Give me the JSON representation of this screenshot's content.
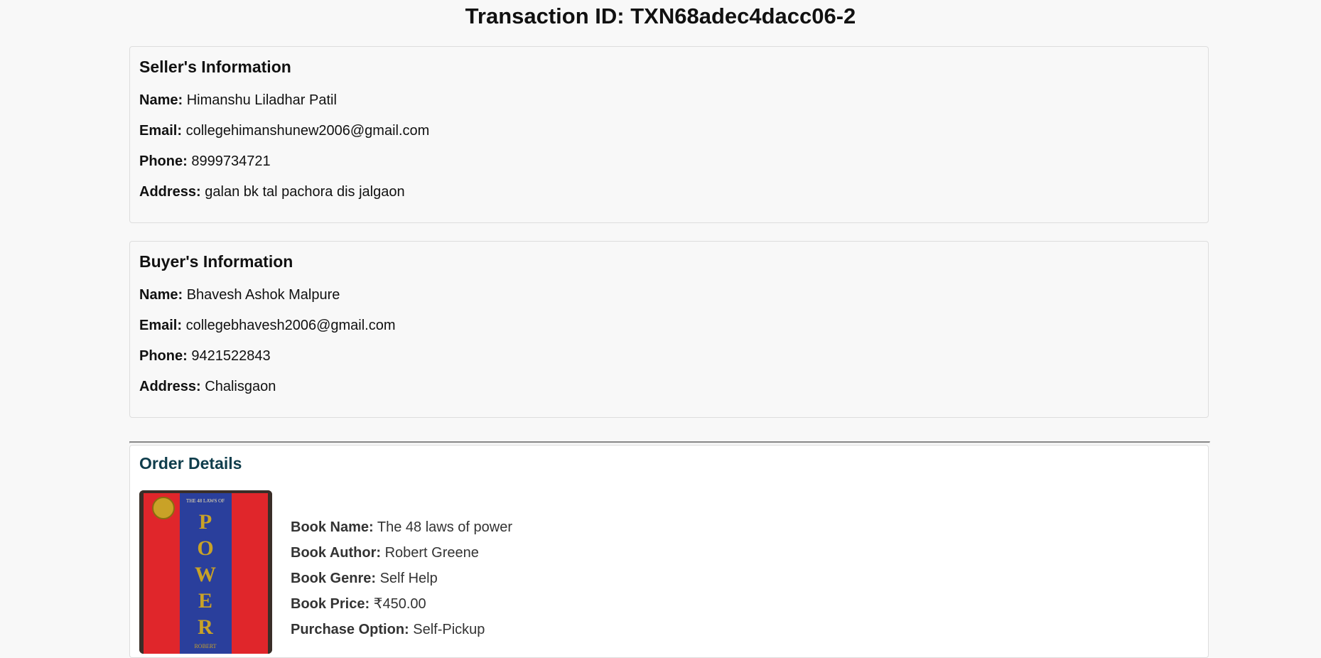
{
  "page": {
    "title": "Transaction ID: TXN68adec4dacc06-2"
  },
  "seller": {
    "heading": "Seller's Information",
    "name_label": "Name:",
    "name": "Himanshu Liladhar Patil",
    "email_label": "Email:",
    "email": "collegehimanshunew2006@gmail.com",
    "phone_label": "Phone:",
    "phone": "8999734721",
    "address_label": "Address:",
    "address": "galan bk tal pachora dis jalgaon"
  },
  "buyer": {
    "heading": "Buyer's Information",
    "name_label": "Name:",
    "name": "Bhavesh Ashok Malpure",
    "email_label": "Email:",
    "email": "collegebhavesh2006@gmail.com",
    "phone_label": "Phone:",
    "phone": "9421522843",
    "address_label": "Address:",
    "address": "Chalisgaon"
  },
  "order": {
    "heading": "Order Details",
    "heading_color": "#0f3d4c",
    "cover": {
      "top_text": "THE 48 LAWS OF",
      "title_letters": [
        "P",
        "O",
        "W",
        "E",
        "R"
      ],
      "author_text": "ROBERT",
      "colors": {
        "red": "#e0262b",
        "blue": "#2a3f9c",
        "gold": "#c9a227"
      }
    },
    "book_name_label": "Book Name:",
    "book_name": "The 48 laws of power",
    "book_author_label": "Book Author:",
    "book_author": "Robert Greene",
    "book_genre_label": "Book Genre:",
    "book_genre": "Self Help",
    "book_price_label": "Book Price:",
    "book_price": "₹450.00",
    "purchase_option_label": "Purchase Option:",
    "purchase_option": "Self-Pickup"
  }
}
